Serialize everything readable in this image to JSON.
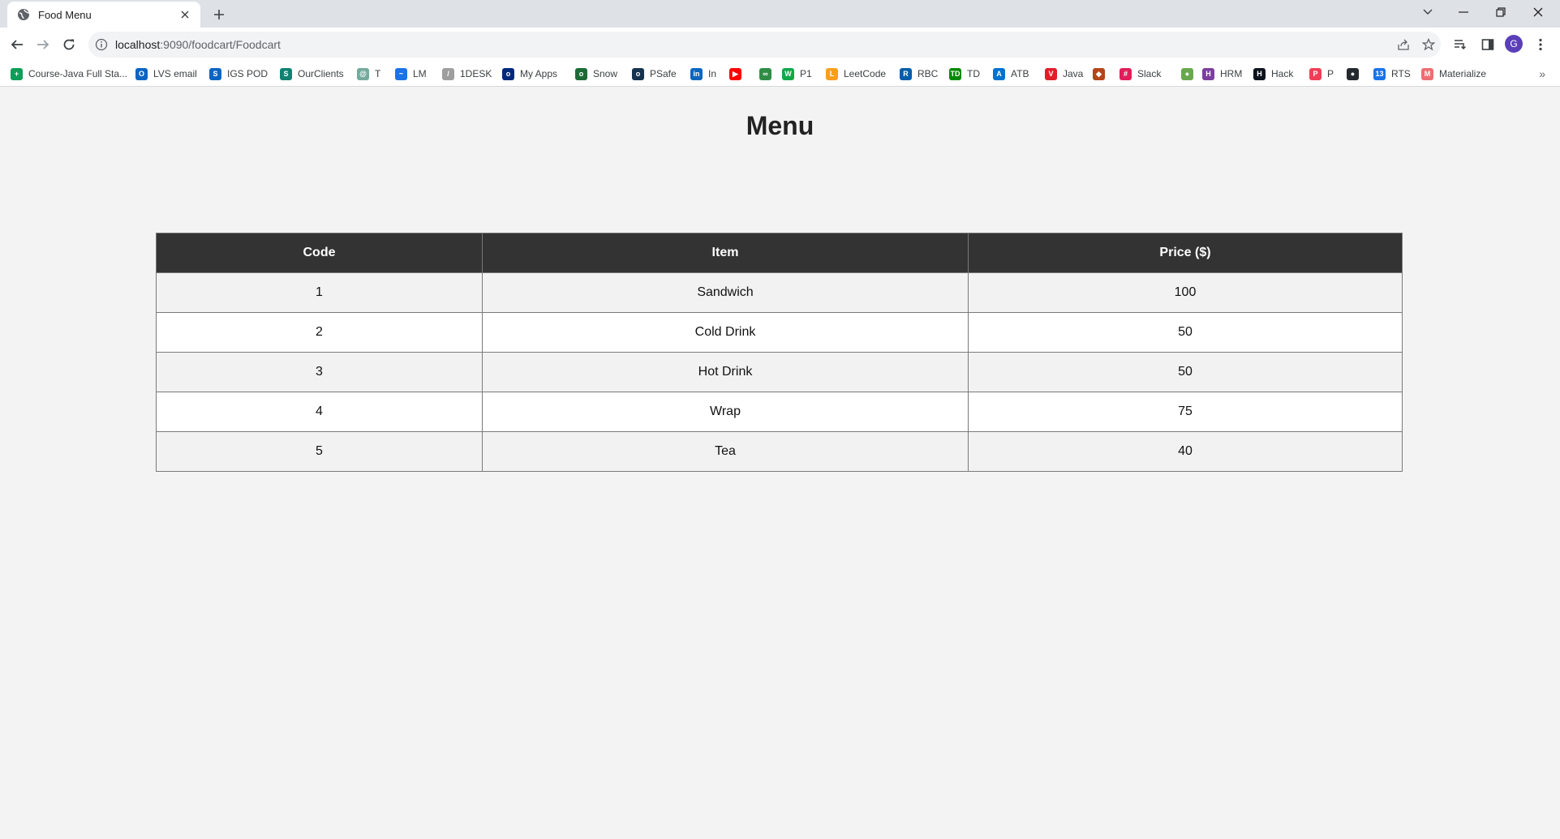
{
  "browser": {
    "tab_title": "Food Menu",
    "url_host": "localhost",
    "url_rest": ":9090/foodcart/Foodcart",
    "avatar_letter": "G"
  },
  "bookmarks": [
    {
      "label": "Course-Java Full Sta...",
      "icon": "sheets-icon",
      "color": "#0f9d58",
      "glyph": "+"
    },
    {
      "label": "LVS email",
      "icon": "outlook-icon",
      "color": "#0a64c4",
      "glyph": "O"
    },
    {
      "label": "IGS POD",
      "icon": "sharepoint-icon",
      "color": "#0a64c4",
      "glyph": "S"
    },
    {
      "label": "OurClients",
      "icon": "sharepoint-green-icon",
      "color": "#108272",
      "glyph": "S"
    },
    {
      "label": "T",
      "icon": "chatgpt-icon",
      "color": "#74aa9c",
      "glyph": "@"
    },
    {
      "label": "LM",
      "icon": "pulse-icon",
      "color": "#1a73e8",
      "glyph": "~"
    },
    {
      "label": "1DESK",
      "icon": "chart-icon",
      "color": "#9e9e9e",
      "glyph": "/"
    },
    {
      "label": "My Apps",
      "icon": "okta-icon",
      "color": "#00297a",
      "glyph": "o"
    },
    {
      "label": "Snow",
      "icon": "servicenow-icon",
      "color": "#1c6b36",
      "glyph": "o"
    },
    {
      "label": "PSafe",
      "icon": "psafe-icon",
      "color": "#16324f",
      "glyph": "o"
    },
    {
      "label": "In",
      "icon": "linkedin-icon",
      "color": "#0a66c2",
      "glyph": "in"
    },
    {
      "label": "",
      "icon": "youtube-icon",
      "color": "#ff0000",
      "glyph": "▶"
    },
    {
      "label": "",
      "icon": "geeksforgeeks-icon",
      "color": "#2f8d46",
      "glyph": "∞"
    },
    {
      "label": "P1",
      "icon": "w-icon",
      "color": "#11a84a",
      "glyph": "W"
    },
    {
      "label": "LeetCode",
      "icon": "leetcode-icon",
      "color": "#f89f1b",
      "glyph": "L"
    },
    {
      "label": "RBC",
      "icon": "rbc-icon",
      "color": "#005daa",
      "glyph": "R"
    },
    {
      "label": "TD",
      "icon": "td-icon",
      "color": "#008a00",
      "glyph": "TD"
    },
    {
      "label": "ATB",
      "icon": "atb-icon",
      "color": "#0072ce",
      "glyph": "A"
    },
    {
      "label": "Java",
      "icon": "java-v-icon",
      "color": "#e11d2a",
      "glyph": "V"
    },
    {
      "label": "",
      "icon": "shield-icon",
      "color": "#b5451b",
      "glyph": "◆"
    },
    {
      "label": "Slack",
      "icon": "slack-icon",
      "color": "#e01e5a",
      "glyph": "#"
    },
    {
      "label": "",
      "icon": "globe-icon",
      "color": "#6aa84f",
      "glyph": "●"
    },
    {
      "label": "HRM",
      "icon": "hrm-icon",
      "color": "#7b3fa0",
      "glyph": "H"
    },
    {
      "label": "Hack",
      "icon": "hackerrank-icon",
      "color": "#0e141e",
      "glyph": "H"
    },
    {
      "label": "P",
      "icon": "pocket-icon",
      "color": "#ef3f56",
      "glyph": "P"
    },
    {
      "label": "",
      "icon": "github-icon",
      "color": "#24292f",
      "glyph": "●"
    },
    {
      "label": "RTS",
      "icon": "calendar-icon",
      "color": "#1a73e8",
      "glyph": "13"
    },
    {
      "label": "Materialize",
      "icon": "materialize-icon",
      "color": "#ee6e73",
      "glyph": "M"
    }
  ],
  "page": {
    "title": "Menu",
    "columns": [
      "Code",
      "Item",
      "Price ($)"
    ],
    "rows": [
      [
        "1",
        "Sandwich",
        "100"
      ],
      [
        "2",
        "Cold Drink",
        "50"
      ],
      [
        "3",
        "Hot Drink",
        "50"
      ],
      [
        "4",
        "Wrap",
        "75"
      ],
      [
        "5",
        "Tea",
        "40"
      ]
    ]
  }
}
